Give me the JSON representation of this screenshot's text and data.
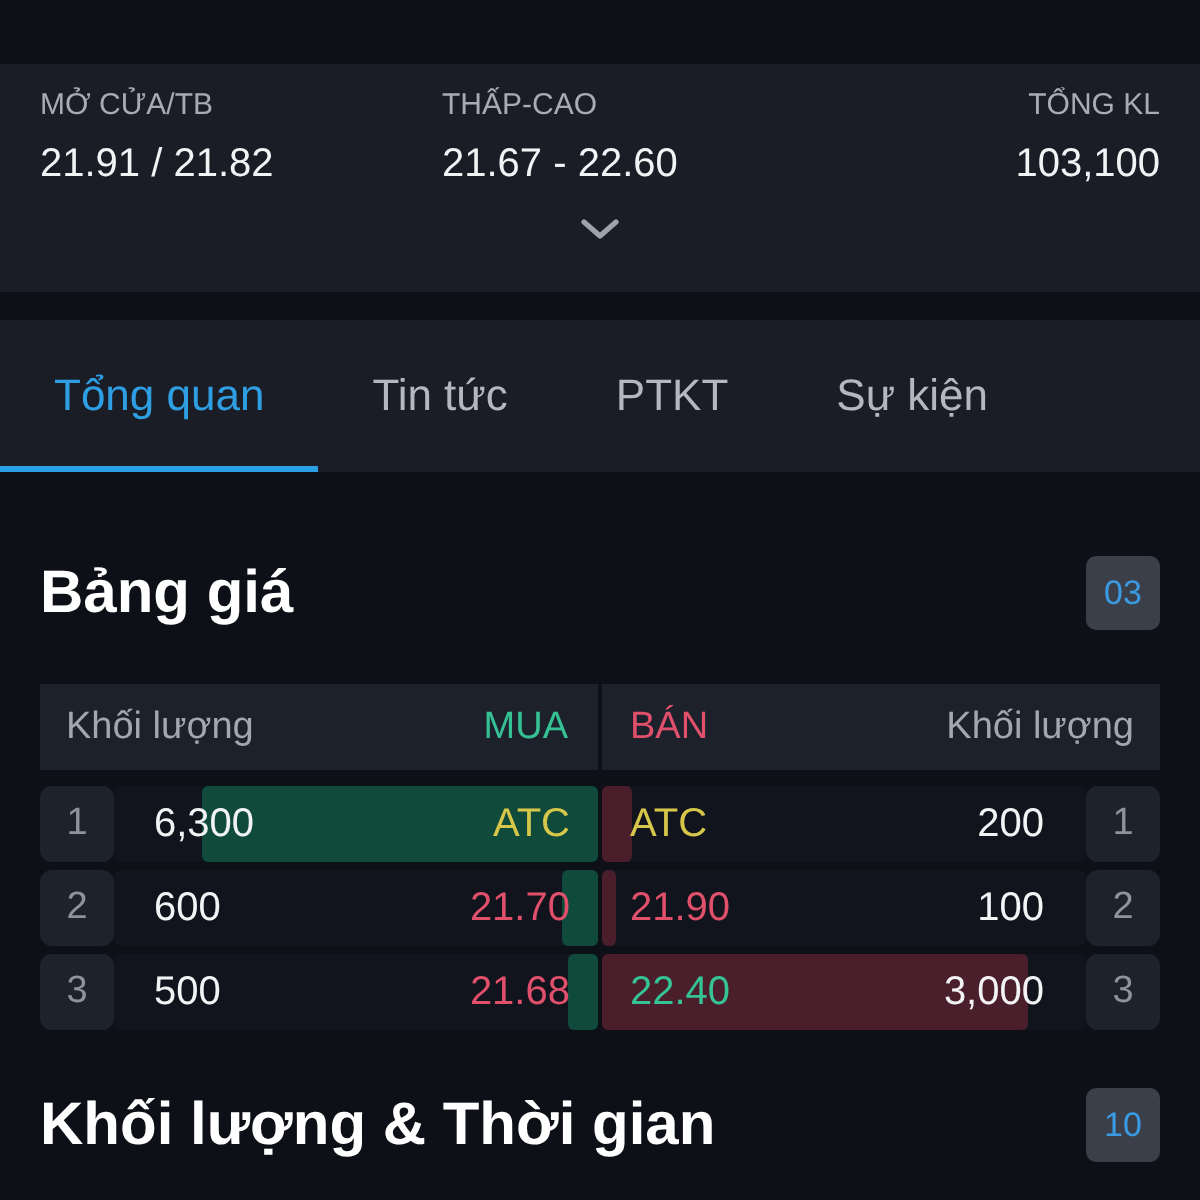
{
  "stats": [
    {
      "label": "MỞ CỬA/TB",
      "value": "21.91 / 21.82"
    },
    {
      "label": "THẤP-CAO",
      "value": "21.67 - 22.60"
    },
    {
      "label": "TỔNG KL",
      "value": "103,100"
    }
  ],
  "tabs": [
    {
      "label": "Tổng quan",
      "selected": true
    },
    {
      "label": "Tin tức",
      "selected": false
    },
    {
      "label": "PTKT",
      "selected": false
    },
    {
      "label": "Sự kiện",
      "selected": false
    }
  ],
  "order_book": {
    "title": "Bảng giá",
    "badge": "03",
    "header": {
      "buy_volume": "Khối lượng",
      "buy": "MUA",
      "sell": "BÁN",
      "sell_volume": "Khối lượng"
    },
    "rows": [
      {
        "buy": {
          "rank": "1",
          "volume": "6,300",
          "price": "ATC",
          "color": "#d6c64a",
          "level": 0.82
        },
        "sell": {
          "price": "ATC",
          "color": "#d6c64a",
          "volume": "200",
          "rank": "1",
          "level": 0.06
        }
      },
      {
        "buy": {
          "rank": "2",
          "volume": "600",
          "price": "21.70",
          "color": "#e0506b",
          "level": 0.075
        },
        "sell": {
          "price": "21.90",
          "color": "#e0506b",
          "volume": "100",
          "rank": "2",
          "level": 0.03
        }
      },
      {
        "buy": {
          "rank": "3",
          "volume": "500",
          "price": "21.68",
          "color": "#e0506b",
          "level": 0.06
        },
        "sell": {
          "price": "22.40",
          "color": "#35c394",
          "volume": "3,000",
          "rank": "3",
          "level": 0.88
        }
      }
    ]
  },
  "trades": {
    "title": "Khối lượng & Thời gian",
    "badge": "10"
  }
}
